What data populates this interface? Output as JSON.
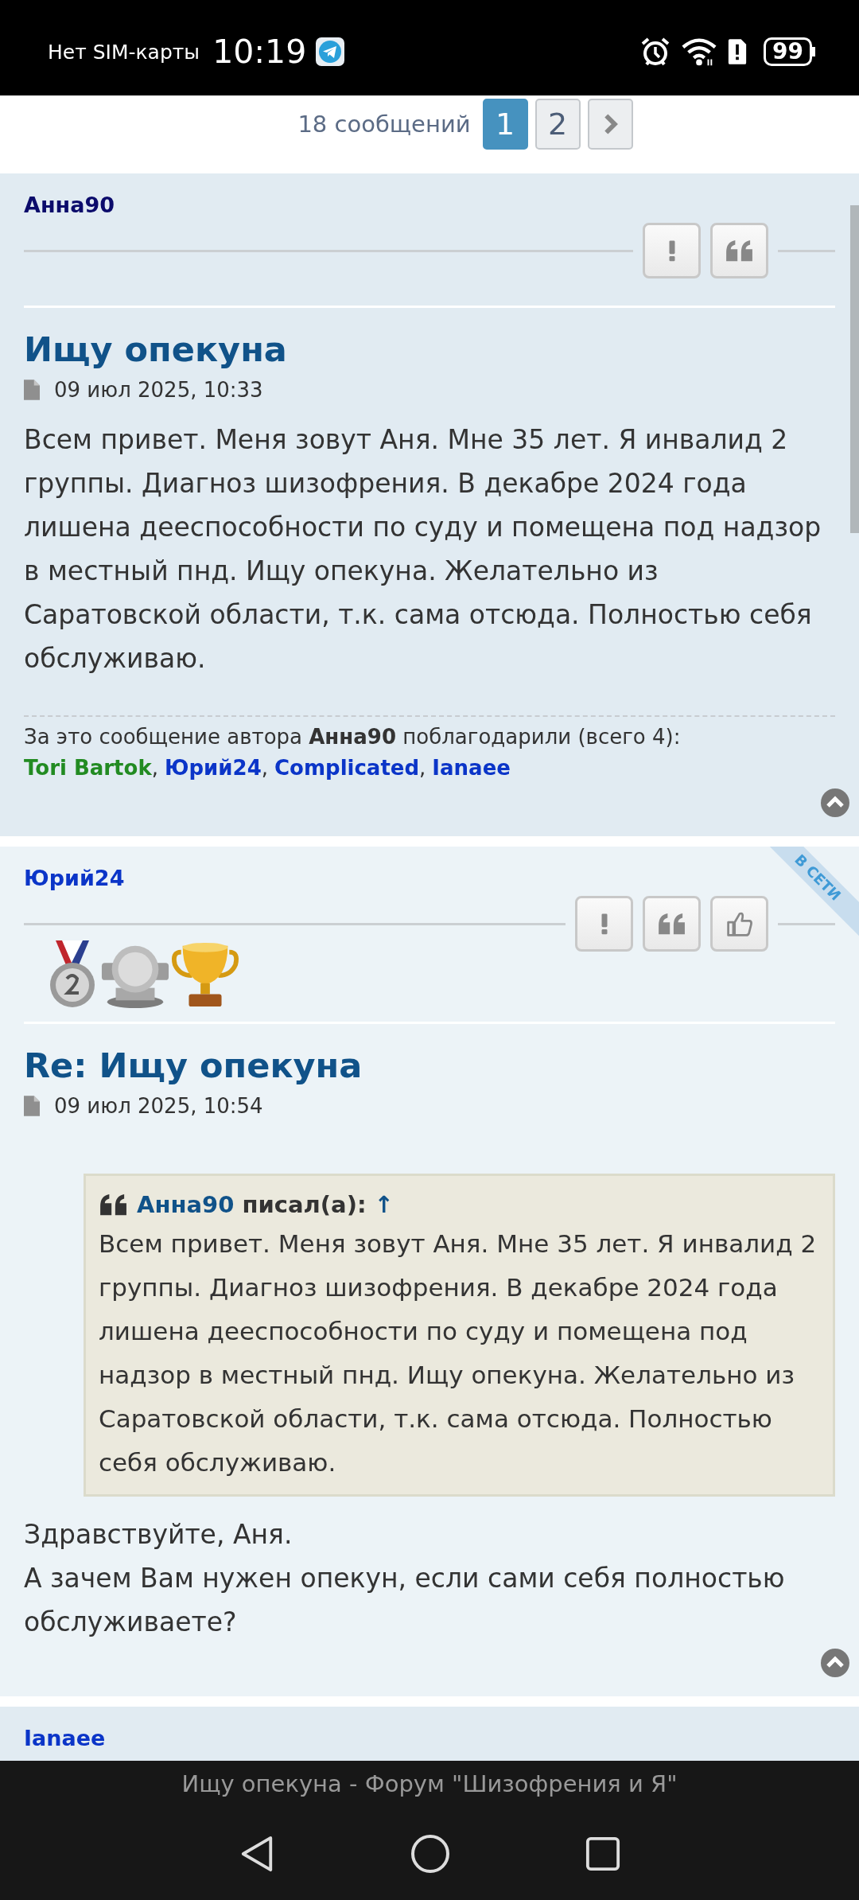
{
  "status_bar": {
    "carrier": "Нет SIM-карты",
    "time": "10:19",
    "battery": "99"
  },
  "pagination": {
    "count": "18 сообщений",
    "pages": [
      {
        "label": "1",
        "selected": true
      },
      {
        "label": "2",
        "selected": false
      }
    ]
  },
  "posts": [
    {
      "author": {
        "name": "Анна90",
        "color": "#0b0b6b"
      },
      "online": false,
      "buttons": [
        {
          "kind": "report"
        },
        {
          "kind": "quote"
        }
      ],
      "title": "Ищу опекуна",
      "date": "09 июл 2025, 10:33",
      "body": [
        "Всем привет. Меня зовут Аня. Мне 35 лет. Я инвалид 2 группы. Диагноз шизофрения. В декабре 2024 года лишена дееспособности по суду и помещена под надзор в местный пнд. Ищу опекуна. Желательно из Саратовской области, т.к. сама отсюда. Полностью себя обслуживаю."
      ],
      "thanks": {
        "text": "За это сообщение автора **Анна90** поблагодарили (всего 4):",
        "separator": ",",
        "names": [
          {
            "name": "Tori Bartok",
            "color": "#228b22"
          },
          {
            "name": "Юрий24",
            "color": "#0b35c8"
          },
          {
            "name": "Complicated",
            "color": "#0b35c8"
          },
          {
            "name": "Ianaee",
            "color": "#0b35c8"
          }
        ]
      }
    },
    {
      "author": {
        "name": "Юрий24",
        "color": "#0b35c8"
      },
      "online": true,
      "online_label": "В СЕТИ",
      "buttons": [
        {
          "kind": "report"
        },
        {
          "kind": "quote"
        },
        {
          "kind": "like"
        }
      ],
      "awards": [
        {
          "kind": "medal"
        },
        {
          "kind": "plate"
        },
        {
          "kind": "trophy"
        }
      ],
      "title": "Re: Ищу опекуна",
      "date": "09 июл 2025, 10:54",
      "quote": {
        "author": "Анна90",
        "wrote": "писал(а):",
        "jump": "↑",
        "text": "Всем привет. Меня зовут Аня. Мне 35 лет. Я инвалид 2 группы. Диагноз шизофрения. В декабре 2024 года лишена дееспособности по суду и помещена под надзор в местный пнд. Ищу опекуна. Желательно из Саратовской области, т.к. сама отсюда. Полностью себя обслуживаю."
      },
      "body": [
        "Здравствуйте, Аня.",
        "А зачем Вам нужен опекун, если сами себя полностью обслуживаете?"
      ]
    },
    {
      "author": {
        "name": "Ianaee",
        "color": "#0b35c8"
      },
      "online": false
    }
  ],
  "bottom_bar": {
    "title": "Ищу опекуна - Форум \"Шизофрения и Я\""
  }
}
